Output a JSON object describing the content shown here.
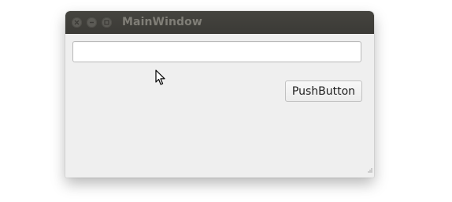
{
  "window": {
    "title": "MainWindow",
    "controls": [
      "close-icon",
      "minimize-icon",
      "maximize-icon"
    ]
  },
  "line_edit": {
    "value": "",
    "placeholder": ""
  },
  "push_button": {
    "label": "PushButton"
  },
  "colors": {
    "titlebar": "#3c3b37",
    "window_bg": "#efefef",
    "title_text": "#807e77"
  }
}
